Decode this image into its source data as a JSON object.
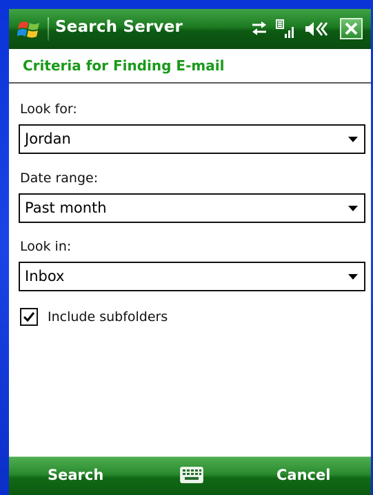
{
  "titlebar": {
    "title": "Search Server",
    "icons": [
      "windows-start-icon",
      "sync-arrows-icon",
      "signal-strength-icon",
      "volume-icon",
      "close-icon"
    ]
  },
  "header": {
    "title": "Criteria for Finding E-mail"
  },
  "form": {
    "look_for": {
      "label": "Look for:",
      "value": "Jordan"
    },
    "date_range": {
      "label": "Date range:",
      "value": "Past month"
    },
    "look_in": {
      "label": "Look in:",
      "value": "Inbox"
    },
    "include_subfolders": {
      "label": "Include subfolders",
      "checked": true
    }
  },
  "softkeys": {
    "left": "Search",
    "center_icon": "keyboard-icon",
    "right": "Cancel"
  },
  "colors": {
    "accent_green": "#1a9a1a",
    "titlebar_green": "#1d7a22",
    "frame_blue": "#0b34d8"
  }
}
